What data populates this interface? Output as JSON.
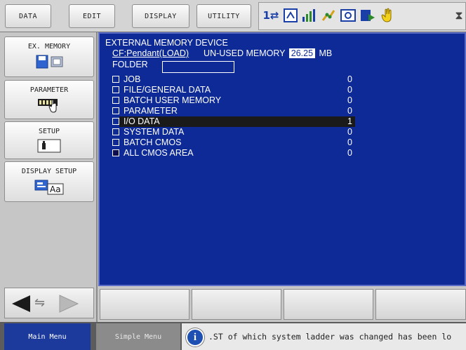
{
  "top_menu": {
    "tabs": [
      {
        "label": "DATA"
      },
      {
        "label": "EDIT"
      },
      {
        "label": "DISPLAY"
      },
      {
        "label": "UTILITY"
      }
    ]
  },
  "status_icons": [
    "arrows-icon",
    "mode-icon",
    "signal-icon",
    "robot-icon",
    "panel-icon",
    "play-icon",
    "hand-icon",
    "hourglass-icon"
  ],
  "sidebar": {
    "items": [
      {
        "label": "EX. MEMORY"
      },
      {
        "label": "PARAMETER"
      },
      {
        "label": "SETUP"
      },
      {
        "label": "DISPLAY SETUP"
      }
    ]
  },
  "main": {
    "title": "EXTERNAL MEMORY DEVICE",
    "device": "CF:Pendant(LOAD)",
    "unused_label": "UN-USED MEMORY",
    "unused_value": "26.25",
    "unused_unit": "MB",
    "folder_label": "FOLDER",
    "rows": [
      {
        "label": "JOB",
        "value": "0",
        "checked": false,
        "selected": false
      },
      {
        "label": "FILE/GENERAL DATA",
        "value": "0",
        "checked": false,
        "selected": false
      },
      {
        "label": "BATCH USER MEMORY",
        "value": "0",
        "checked": false,
        "selected": false
      },
      {
        "label": "PARAMETER",
        "value": "0",
        "checked": false,
        "selected": false
      },
      {
        "label": "I/O DATA",
        "value": "1",
        "checked": false,
        "selected": true
      },
      {
        "label": "SYSTEM DATA",
        "value": "0",
        "checked": false,
        "selected": false
      },
      {
        "label": "BATCH CMOS",
        "value": "0",
        "checked": false,
        "selected": false
      },
      {
        "label": "ALL CMOS AREA",
        "value": "0",
        "checked": true,
        "selected": false
      }
    ]
  },
  "bottom": {
    "main_menu": "Main Menu",
    "simple_menu": "Simple Menu",
    "message": ".ST of which system ladder was changed has been lo"
  },
  "colors": {
    "main_bg": "#0d2a96",
    "selected_row": "#1a1a1a",
    "main_menu_bg": "#1b3a9c"
  }
}
